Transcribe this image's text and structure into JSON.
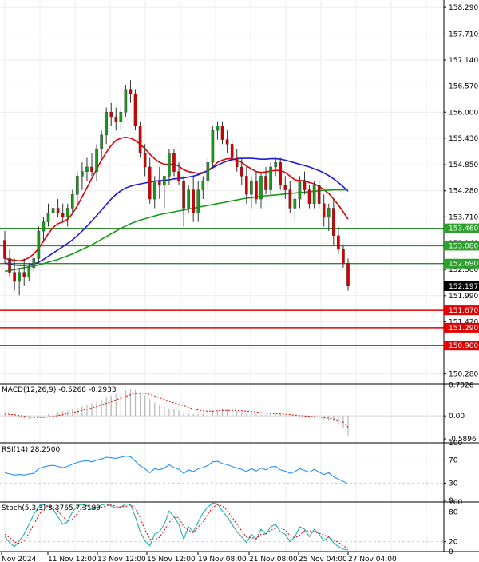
{
  "chart_data": {
    "type": "candlestick",
    "instrument_price_axis": {
      "ticks": [
        "158.290",
        "157.710",
        "157.140",
        "156.570",
        "156.000",
        "155.430",
        "154.850",
        "154.280",
        "153.710",
        "153.140",
        "152.560",
        "151.990",
        "151.420",
        "150.850",
        "150.280"
      ],
      "range": [
        150.1,
        158.45
      ]
    },
    "price_levels": {
      "green": [
        {
          "value": 153.46,
          "label": "153.460"
        },
        {
          "value": 153.08,
          "label": "153.080"
        },
        {
          "value": 152.69,
          "label": "152.690"
        }
      ],
      "red": [
        {
          "value": 151.67,
          "label": "151.670"
        },
        {
          "value": 151.29,
          "label": "151.290"
        },
        {
          "value": 150.9,
          "label": "150.900"
        }
      ],
      "current": {
        "value": 152.197,
        "label": "152.197"
      }
    },
    "time_labels": [
      "Nov 2024",
      "11 Nov 12:00",
      "13 Nov 12:00",
      "15 Nov 12:00",
      "19 Nov 08:00",
      "21 Nov 08:00",
      "25 Nov 04:00",
      "27 Nov 04:00"
    ],
    "candles_ohlc": [
      [
        153.2,
        153.4,
        152.7,
        152.8
      ],
      [
        152.8,
        153.0,
        152.4,
        152.5
      ],
      [
        152.5,
        152.8,
        152.1,
        152.3
      ],
      [
        152.3,
        152.6,
        152.0,
        152.5
      ],
      [
        152.5,
        152.8,
        152.2,
        152.4
      ],
      [
        152.4,
        152.7,
        152.3,
        152.6
      ],
      [
        152.6,
        152.9,
        152.5,
        152.8
      ],
      [
        152.8,
        153.5,
        152.7,
        153.4
      ],
      [
        153.4,
        153.7,
        153.2,
        153.6
      ],
      [
        153.6,
        154.0,
        153.5,
        153.8
      ],
      [
        153.8,
        154.0,
        153.6,
        153.9
      ],
      [
        153.9,
        154.1,
        153.7,
        153.8
      ],
      [
        153.8,
        154.0,
        153.6,
        153.7
      ],
      [
        153.7,
        154.0,
        153.5,
        153.9
      ],
      [
        153.9,
        154.3,
        153.8,
        154.2
      ],
      [
        154.2,
        154.7,
        154.0,
        154.6
      ],
      [
        154.6,
        154.9,
        154.3,
        154.7
      ],
      [
        154.7,
        155.0,
        154.5,
        154.8
      ],
      [
        154.8,
        155.1,
        154.6,
        154.7
      ],
      [
        154.7,
        155.3,
        154.5,
        155.2
      ],
      [
        155.2,
        155.6,
        155.0,
        155.5
      ],
      [
        155.5,
        156.1,
        155.3,
        156.0
      ],
      [
        156.0,
        156.2,
        155.7,
        155.9
      ],
      [
        155.9,
        156.1,
        155.6,
        155.8
      ],
      [
        155.8,
        156.1,
        155.6,
        156.0
      ],
      [
        156.0,
        156.6,
        155.9,
        156.5
      ],
      [
        156.5,
        156.7,
        156.2,
        156.4
      ],
      [
        156.4,
        156.5,
        155.6,
        155.7
      ],
      [
        155.7,
        155.8,
        155.0,
        155.1
      ],
      [
        155.1,
        155.3,
        154.6,
        154.8
      ],
      [
        154.8,
        155.0,
        154.0,
        154.1
      ],
      [
        154.1,
        154.6,
        153.9,
        154.5
      ],
      [
        154.5,
        154.8,
        154.1,
        154.4
      ],
      [
        154.4,
        154.6,
        153.9,
        154.6
      ],
      [
        154.6,
        155.2,
        154.4,
        155.1
      ],
      [
        155.1,
        155.2,
        154.6,
        154.7
      ],
      [
        154.7,
        154.9,
        154.4,
        154.5
      ],
      [
        154.5,
        154.6,
        153.5,
        153.9
      ],
      [
        153.9,
        154.4,
        153.8,
        154.3
      ],
      [
        154.3,
        154.6,
        153.6,
        153.8
      ],
      [
        153.8,
        154.5,
        153.6,
        154.3
      ],
      [
        154.3,
        154.6,
        154.1,
        154.5
      ],
      [
        154.5,
        155.0,
        154.3,
        154.9
      ],
      [
        154.9,
        155.7,
        154.8,
        155.6
      ],
      [
        155.6,
        155.8,
        155.4,
        155.7
      ],
      [
        155.7,
        155.8,
        155.3,
        155.4
      ],
      [
        155.4,
        155.6,
        155.1,
        155.3
      ],
      [
        155.3,
        155.4,
        154.9,
        155.0
      ],
      [
        155.0,
        155.2,
        154.7,
        154.8
      ],
      [
        154.8,
        155.0,
        154.4,
        154.6
      ],
      [
        154.6,
        154.8,
        154.0,
        154.2
      ],
      [
        154.2,
        154.6,
        153.9,
        154.5
      ],
      [
        154.5,
        154.7,
        154.0,
        154.1
      ],
      [
        154.1,
        154.7,
        153.9,
        154.6
      ],
      [
        154.6,
        154.8,
        154.2,
        154.3
      ],
      [
        154.3,
        154.9,
        154.2,
        154.8
      ],
      [
        154.8,
        155.0,
        154.6,
        154.9
      ],
      [
        154.9,
        155.0,
        154.3,
        154.4
      ],
      [
        154.4,
        154.6,
        154.1,
        154.3
      ],
      [
        154.3,
        154.5,
        153.8,
        153.9
      ],
      [
        153.9,
        154.2,
        153.6,
        154.1
      ],
      [
        154.1,
        154.6,
        153.9,
        154.5
      ],
      [
        154.5,
        154.7,
        154.2,
        154.3
      ],
      [
        154.3,
        154.4,
        153.9,
        154.0
      ],
      [
        154.0,
        154.5,
        153.9,
        154.4
      ],
      [
        154.4,
        154.5,
        153.9,
        154.0
      ],
      [
        154.0,
        154.2,
        153.5,
        153.7
      ],
      [
        153.7,
        154.0,
        153.4,
        153.9
      ],
      [
        153.9,
        154.1,
        153.1,
        153.3
      ],
      [
        153.3,
        153.5,
        152.9,
        153.0
      ],
      [
        153.0,
        153.1,
        152.6,
        152.7
      ],
      [
        152.7,
        152.8,
        152.1,
        152.2
      ]
    ],
    "moving_averages": [
      {
        "color": "#e00000",
        "values": [
          152.8,
          152.78,
          152.76,
          152.75,
          152.77,
          152.82,
          152.9,
          153.02,
          153.18,
          153.34,
          153.48,
          153.56,
          153.6,
          153.66,
          153.78,
          153.95,
          154.15,
          154.35,
          154.55,
          154.75,
          154.95,
          155.12,
          155.27,
          155.38,
          155.43,
          155.45,
          155.43,
          155.38,
          155.3,
          155.2,
          155.08,
          154.98,
          154.9,
          154.86,
          154.86,
          154.86,
          154.82,
          154.74,
          154.7,
          154.68,
          154.66,
          154.68,
          154.72,
          154.8,
          154.9,
          154.95,
          154.98,
          154.98,
          154.95,
          154.9,
          154.82,
          154.76,
          154.7,
          154.68,
          154.69,
          154.71,
          154.73,
          154.72,
          154.68,
          154.6,
          154.52,
          154.5,
          154.5,
          154.46,
          154.43,
          154.38,
          154.3,
          154.22,
          154.1,
          153.97,
          153.82,
          153.66
        ]
      },
      {
        "color": "#1a1adc",
        "values": [
          152.7,
          152.68,
          152.66,
          152.65,
          152.65,
          152.66,
          152.68,
          152.72,
          152.78,
          152.85,
          152.92,
          152.99,
          153.06,
          153.13,
          153.21,
          153.3,
          153.4,
          153.51,
          153.62,
          153.74,
          153.86,
          153.98,
          154.1,
          154.2,
          154.28,
          154.34,
          154.38,
          154.41,
          154.43,
          154.45,
          154.47,
          154.49,
          154.5,
          154.51,
          154.52,
          154.54,
          154.55,
          154.56,
          154.58,
          154.6,
          154.63,
          154.67,
          154.72,
          154.78,
          154.84,
          154.89,
          154.93,
          154.96,
          154.98,
          154.99,
          154.99,
          154.99,
          154.98,
          154.97,
          154.97,
          154.98,
          154.98,
          154.97,
          154.95,
          154.92,
          154.89,
          154.86,
          154.83,
          154.8,
          154.76,
          154.72,
          154.67,
          154.61,
          154.54,
          154.46,
          154.37,
          154.27
        ]
      },
      {
        "color": "#1a9a1a",
        "values": [
          152.52,
          152.54,
          152.56,
          152.58,
          152.6,
          152.62,
          152.64,
          152.66,
          152.69,
          152.72,
          152.75,
          152.78,
          152.82,
          152.86,
          152.9,
          152.95,
          153.0,
          153.05,
          153.1,
          153.16,
          153.22,
          153.28,
          153.34,
          153.4,
          153.46,
          153.51,
          153.56,
          153.6,
          153.64,
          153.67,
          153.7,
          153.73,
          153.76,
          153.78,
          153.8,
          153.82,
          153.84,
          153.86,
          153.88,
          153.9,
          153.92,
          153.94,
          153.96,
          153.98,
          154.0,
          154.02,
          154.04,
          154.06,
          154.08,
          154.1,
          154.12,
          154.13,
          154.15,
          154.16,
          154.17,
          154.18,
          154.19,
          154.2,
          154.21,
          154.22,
          154.23,
          154.24,
          154.25,
          154.26,
          154.27,
          154.28,
          154.29,
          154.29,
          154.3,
          154.3,
          154.3,
          154.3
        ]
      }
    ],
    "macd": {
      "label": "MACD(12,26,9) -0.5268 -0.2933",
      "ticks": [
        "0.7926",
        "0.00",
        "-0.5896"
      ],
      "range": [
        -0.65,
        0.82
      ],
      "histogram": [
        0.05,
        0.02,
        -0.02,
        -0.05,
        -0.07,
        -0.08,
        -0.07,
        -0.04,
        0.0,
        0.04,
        0.07,
        0.1,
        0.12,
        0.14,
        0.17,
        0.2,
        0.24,
        0.28,
        0.32,
        0.36,
        0.42,
        0.47,
        0.52,
        0.56,
        0.6,
        0.65,
        0.68,
        0.66,
        0.6,
        0.52,
        0.42,
        0.34,
        0.27,
        0.22,
        0.19,
        0.17,
        0.14,
        0.1,
        0.07,
        0.05,
        0.04,
        0.05,
        0.08,
        0.12,
        0.16,
        0.17,
        0.16,
        0.15,
        0.13,
        0.1,
        0.08,
        0.06,
        0.04,
        0.03,
        0.03,
        0.04,
        0.05,
        0.04,
        0.02,
        -0.01,
        -0.03,
        -0.03,
        -0.04,
        -0.06,
        -0.06,
        -0.07,
        -0.09,
        -0.11,
        -0.15,
        -0.21,
        -0.32,
        -0.5
      ],
      "signal": [
        0.05,
        0.04,
        0.03,
        0.01,
        -0.01,
        -0.03,
        -0.04,
        -0.04,
        -0.04,
        -0.03,
        -0.01,
        0.01,
        0.03,
        0.06,
        0.08,
        0.11,
        0.14,
        0.17,
        0.2,
        0.24,
        0.28,
        0.32,
        0.36,
        0.41,
        0.45,
        0.5,
        0.54,
        0.57,
        0.58,
        0.58,
        0.55,
        0.51,
        0.46,
        0.42,
        0.37,
        0.33,
        0.29,
        0.26,
        0.22,
        0.18,
        0.15,
        0.13,
        0.12,
        0.12,
        0.13,
        0.14,
        0.14,
        0.14,
        0.14,
        0.13,
        0.12,
        0.11,
        0.1,
        0.08,
        0.07,
        0.06,
        0.06,
        0.05,
        0.04,
        0.03,
        0.02,
        0.01,
        0.0,
        -0.01,
        -0.02,
        -0.03,
        -0.04,
        -0.06,
        -0.08,
        -0.11,
        -0.16,
        -0.29
      ]
    },
    "rsi": {
      "label": "RSI(14) 28.2500",
      "ticks": [
        "100",
        "70",
        "30",
        "0"
      ],
      "range": [
        0,
        100
      ],
      "values": [
        48,
        46,
        44,
        45,
        44,
        46,
        47,
        55,
        58,
        60,
        61,
        59,
        57,
        59,
        63,
        66,
        68,
        69,
        67,
        70,
        72,
        75,
        74,
        73,
        75,
        77,
        76,
        68,
        60,
        55,
        48,
        55,
        53,
        56,
        62,
        57,
        54,
        47,
        53,
        50,
        55,
        57,
        61,
        67,
        68,
        64,
        62,
        59,
        56,
        54,
        50,
        55,
        51,
        56,
        53,
        58,
        59,
        53,
        51,
        47,
        50,
        55,
        52,
        49,
        54,
        49,
        45,
        48,
        41,
        37,
        33,
        28.25
      ]
    },
    "stochastic": {
      "label": "Stoch(5,3,3) 3.3765 7.3189",
      "ticks": [
        "100",
        "80",
        "20",
        "0"
      ],
      "range": [
        0,
        100
      ],
      "main": [
        30,
        18,
        10,
        22,
        35,
        55,
        75,
        90,
        95,
        92,
        85,
        70,
        55,
        60,
        80,
        92,
        95,
        93,
        85,
        88,
        94,
        96,
        92,
        88,
        90,
        96,
        95,
        70,
        40,
        22,
        12,
        35,
        40,
        55,
        82,
        70,
        55,
        25,
        50,
        40,
        60,
        78,
        90,
        98,
        96,
        82,
        70,
        55,
        40,
        30,
        18,
        35,
        25,
        45,
        35,
        50,
        55,
        40,
        35,
        20,
        30,
        50,
        45,
        30,
        45,
        35,
        22,
        30,
        18,
        10,
        5,
        3.38
      ],
      "signal": [
        35,
        28,
        19,
        17,
        22,
        37,
        55,
        73,
        87,
        92,
        91,
        82,
        70,
        62,
        65,
        77,
        89,
        93,
        91,
        89,
        89,
        93,
        94,
        92,
        90,
        91,
        94,
        87,
        68,
        44,
        25,
        23,
        29,
        43,
        59,
        69,
        69,
        50,
        43,
        38,
        50,
        59,
        76,
        89,
        95,
        92,
        83,
        69,
        55,
        42,
        29,
        28,
        26,
        35,
        35,
        43,
        47,
        48,
        43,
        32,
        28,
        33,
        42,
        42,
        40,
        37,
        34,
        29,
        23,
        19,
        11,
        7.32
      ]
    }
  }
}
